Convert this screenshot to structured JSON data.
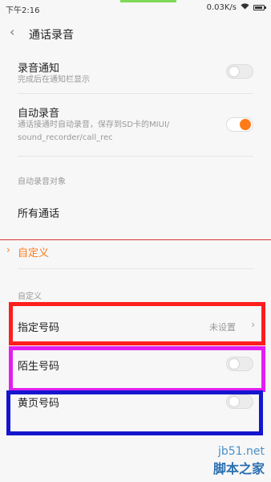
{
  "status_bar": {
    "time": "下午2:16",
    "speed": "0.03K/s",
    "wifi": "wifi-icon",
    "battery": "battery-icon"
  },
  "header": {
    "title": "通话录音",
    "back_icon": "‹"
  },
  "settings": {
    "record_notice": {
      "title": "录音通知",
      "subtitle": "完成后在通知栏显示",
      "enabled": false
    },
    "auto_record": {
      "title": "自动录音",
      "subtitle_line1": "通话接通时自动录音，保存到SD卡的MIUI/",
      "subtitle_line2": "sound_recorder/call_rec",
      "enabled": true
    },
    "auto_record_target_label": "自动录音对象",
    "all_calls": {
      "title": "所有通话"
    },
    "custom_option": {
      "label": "自定义",
      "chevron": "›"
    },
    "custom_section_label": "自定义",
    "specified_numbers": {
      "title": "指定号码",
      "value": "未设置",
      "chevron": "›"
    },
    "unknown_numbers": {
      "title": "陌生号码",
      "enabled": false
    },
    "yellow_page_numbers": {
      "title": "黄页号码",
      "enabled": false
    }
  },
  "annotations": {
    "red": "#ff1e1e",
    "magenta": "#e21ef1",
    "blue": "#1515cf",
    "divider_red": "#dd3333",
    "accent_orange": "#ff7b18"
  },
  "watermark": {
    "top": "jb51.net",
    "bottom": "脚本之家"
  }
}
